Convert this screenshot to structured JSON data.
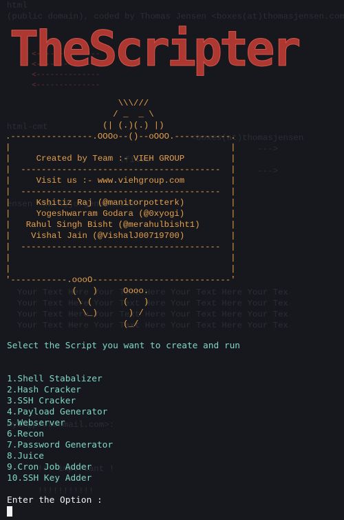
{
  "background_text_lines": [
    "html",
    "(public domain), coded by Thomas Jensen <boxes(at)thomasjensen.com>",
    "",
    "",
    "",
    "",
    "",
    "",
    "",
    "",
    "",
    "html-cmt",
    "                                    <boxes(at)thomasjensen",
    "                                                 --->",
    "                      .files",
    "                                                 --->",
    "",
    "",
    "ensen <karl@jorgensen.com>",
    "",
    "",
    "",
    "",
    "",
    "",
    "",
    "  Your Text Here Your Text Here Your Text Here Your Tex",
    "  Your Text Here Your Text Here Your Text Here Your Tex",
    "  Your Text Here Your Text Here Your Text Here Your Tex",
    "  Your Text Here Your Text Here Your Text Here Your Tex",
    "",
    "",
    "",
    "",
    "",
    "",
    "",
    "",
    "mych@protonmail.com>:",
    "",
    "",
    "",
    "      !!! important !",
    "",
    "      !!!!!!!!!!!"
  ],
  "banner": {
    "title": "TheScripter",
    "arrows": "<--------------\n<--------------\n<--------------\n<--------------"
  },
  "art_lines": [
    "                      \\\\\\///",
    "                     / _  _ \\",
    "                   (| (.)(.) |)",
    ".----------------.OOOo--()--oOOO.-----------.",
    "|                                           |",
    "|     Created by Team :- VIEH GROUP         |",
    "|  ---------------------------------------  |",
    "|     Visit us :- www.viehgroup.com         |",
    "|  ---------------------------------------  |",
    "|     Kshitiz Raj (@manitorpotterk)         |",
    "|     Yogeshwarram Godara (@0xyogi)         |",
    "|   Rahul Singh Bisht (@merahulbisht1)      |",
    "|    Vishal Jain (@VishalJ00719700)         |",
    "|  ---------------------------------------  |",
    "|                                           |",
    "|                                           |",
    "'-----------.oooO---------------------------'",
    "             (   )     Oooo.",
    "              \\ (      (   )",
    "               \\_)      ) /",
    "                       (_/"
  ],
  "menu": {
    "heading": "Select the Script you want to create and run",
    "items": [
      "1.Shell Stabalizer",
      "2.Hash Cracker",
      "3.SSH Cracker",
      "4.Payload Generator",
      "5.Webserver",
      "6.Recon",
      "7.Password Generator",
      "8.Juice",
      "9.Cron Job Adder",
      "10.SSH Key Adder"
    ],
    "prompt": "Enter the Option : "
  },
  "colors": {
    "background": "#16181d",
    "banner": "#b93b33",
    "art": "#e7a14c",
    "menu": "#7fd8c4",
    "prompt": "#f2f2f2",
    "faded_text": "#2b2e35"
  }
}
